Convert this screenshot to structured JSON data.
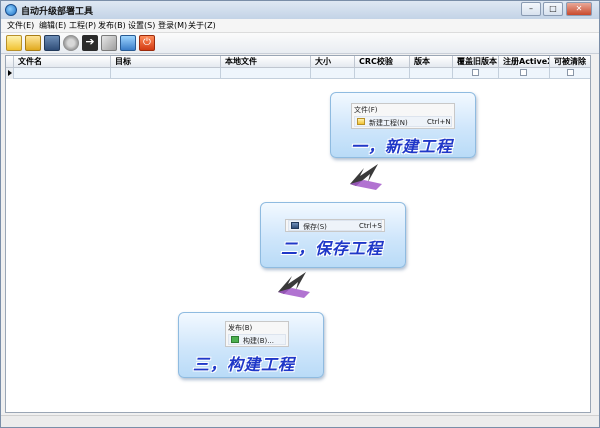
{
  "window": {
    "title": "自动升级部署工具",
    "minimize": "–",
    "maximize": "□",
    "close": "✕"
  },
  "menu": [
    "文件(E)",
    "编辑(E)",
    "工程(P)",
    "发布(B)",
    "设置(S)",
    "登录(M)",
    "关于(Z)"
  ],
  "toolbar_icons": [
    "new-project-icon",
    "open-folder-icon",
    "save-icon",
    "settings-gear-icon",
    "export-arrow-icon",
    "edit-pencil-icon",
    "publish-upload-icon",
    "power-exit-icon"
  ],
  "grid": {
    "headers": [
      "文件名",
      "目标",
      "本地文件",
      "大小",
      "CRC校验",
      "版本",
      "覆盖旧版本",
      "注册ActiveX",
      "可被清除"
    ]
  },
  "steps": [
    {
      "menu_head": "文件(F)",
      "item_label": "新建工程(N)",
      "shortcut": "Ctrl+N",
      "item_icon": "new-project-icon",
      "caption": "一，新建工程"
    },
    {
      "menu_head": "",
      "item_label": "保存(S)",
      "shortcut": "Ctrl+S",
      "item_icon": "save-icon",
      "caption": "二，保存工程"
    },
    {
      "menu_head": "发布(B)",
      "item_label": "构建(B)...",
      "shortcut": "",
      "item_icon": "build-arrow-icon",
      "caption": "三，构建工程"
    }
  ],
  "colors": {
    "caption": "#1f37c8",
    "card_bg": "#cfe6fb",
    "arrow": "#3a3a3a",
    "arrow_accent": "#a35ac9"
  }
}
